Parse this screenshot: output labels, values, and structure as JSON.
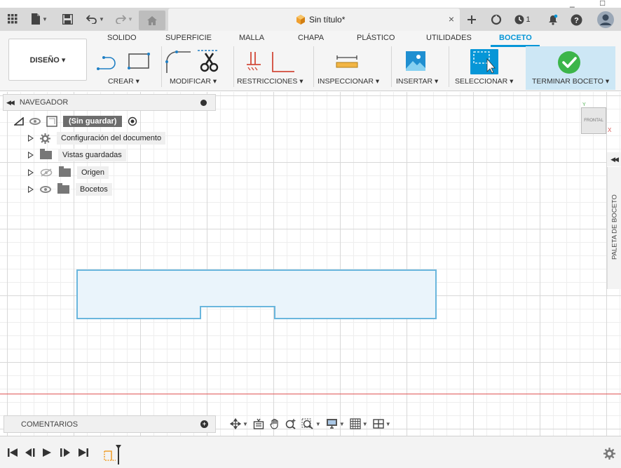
{
  "window": {
    "minimize": "_",
    "restore": "□"
  },
  "document": {
    "title": "Sin título*",
    "close": "×"
  },
  "header": {
    "job_count": "1"
  },
  "ribbon": {
    "tabs": [
      {
        "label": "SOLIDO",
        "active": false
      },
      {
        "label": "SUPERFICIE",
        "active": false
      },
      {
        "label": "MALLA",
        "active": false
      },
      {
        "label": "CHAPA",
        "active": false
      },
      {
        "label": "PLÁSTICO",
        "active": false
      },
      {
        "label": "UTILIDADES",
        "active": false
      },
      {
        "label": "BOCETO",
        "active": true
      }
    ],
    "workspace": "DISEÑO ▾",
    "groups": {
      "create": "CREAR ▾",
      "modify": "MODIFICAR ▾",
      "constraints": "RESTRICCIONES ▾",
      "inspect": "INSPECCIONAR ▾",
      "insert": "INSERTAR ▾",
      "select": "SELECCIONAR ▾",
      "finish": "TERMINAR BOCETO ▾"
    }
  },
  "navigator": {
    "title": "NAVEGADOR",
    "root": "(Sin guardar)",
    "items": [
      {
        "label": "Configuración del documento",
        "icon": "gear-icon"
      },
      {
        "label": "Vistas guardadas",
        "icon": "folder-icon"
      },
      {
        "label": "Origen",
        "icon": "folder-icon",
        "hidden": true
      },
      {
        "label": "Bocetos",
        "icon": "folder-icon"
      }
    ]
  },
  "viewcube": {
    "face": "FRONTAL",
    "axis_y": "Y",
    "axis_x": "X"
  },
  "palette": {
    "label": "PALETA DE BOCETO"
  },
  "comments": {
    "label": "COMENTARIOS"
  },
  "colors": {
    "accent": "#0696d7",
    "sketch_line": "#6ab6dd",
    "sketch_fill": "#eaf4fb",
    "axis_red": "#e05656",
    "finish_green": "#3cb54a"
  }
}
